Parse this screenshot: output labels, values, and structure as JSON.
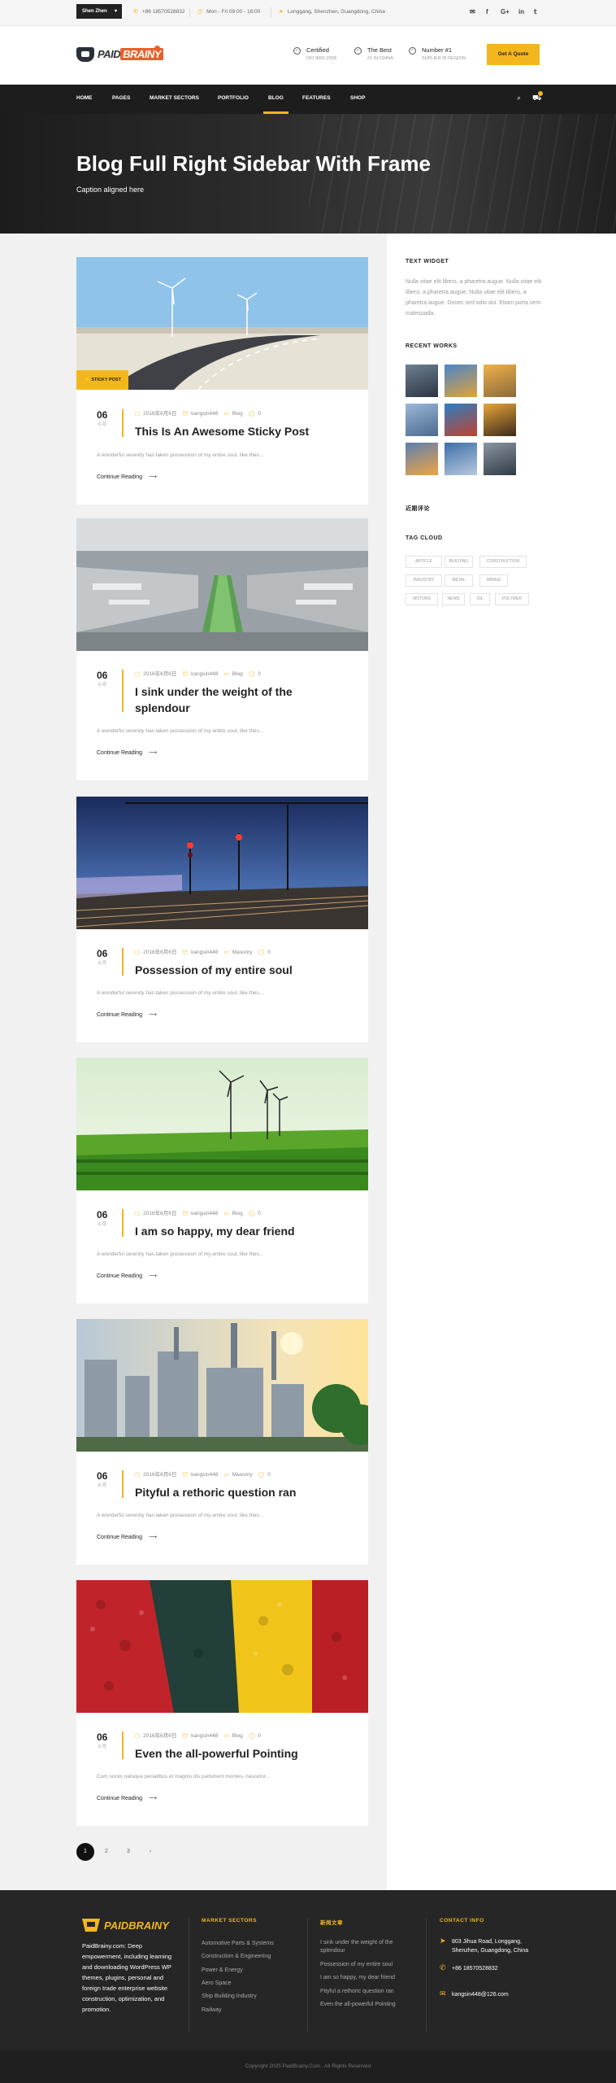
{
  "topbar": {
    "language": "Shen Zhen",
    "phone": "+86 18570528832",
    "hours": "Mon - Fri 09:00 - 18:00",
    "address": "Longgang, Shenzhen, Guangdong, China"
  },
  "header": {
    "logo_main": "PAID",
    "logo_accent": "BRAINY",
    "features": [
      {
        "title": "Certified",
        "sub": "ISO 9001:2008"
      },
      {
        "title": "The Best",
        "sub": "#1 IN CHINA"
      },
      {
        "title": "Number #1",
        "sub": "SUPLIER IN REGION"
      }
    ],
    "quote_button": "Get A Quote"
  },
  "nav": {
    "items": [
      "HOME",
      "PAGES",
      "MARKET SECTORS",
      "PORTFOLIO",
      "BLOG",
      "FEATURES",
      "SHOP"
    ],
    "active": "BLOG"
  },
  "hero": {
    "title": "Blog Full Right Sidebar With Frame",
    "caption": "Caption aligned here"
  },
  "posts": [
    {
      "day": "06",
      "month": "6 月",
      "date": "2016年6月6日",
      "author": "kangsin448",
      "category": "Blog",
      "comments": "0",
      "title": "This Is An Awesome Sticky Post",
      "excerpt": "A wonderful serenity has taken possession of my entire soul, like thes...",
      "more": "Continue Reading",
      "sticky": "STICKY POST",
      "image": "wind-turbines-road"
    },
    {
      "day": "06",
      "month": "6 月",
      "date": "2016年6月6日",
      "author": "kangsin448",
      "category": "Blog",
      "comments": "0",
      "title": "I sink under the weight of the splendour",
      "excerpt": "A wonderful serenity has taken possession of my entire soul, like thes...",
      "more": "Continue Reading",
      "image": "factory-conveyor"
    },
    {
      "day": "06",
      "month": "6 月",
      "date": "2016年6月6日",
      "author": "kangsin448",
      "category": "Masonry",
      "comments": "0",
      "title": "Possession of my entire soul",
      "excerpt": "A wonderful serenity has taken possession of my entire soul, like thes...",
      "more": "Continue Reading",
      "image": "railway-signals"
    },
    {
      "day": "06",
      "month": "6 月",
      "date": "2016年6月6日",
      "author": "kangsin448",
      "category": "Blog",
      "comments": "0",
      "title": "I am so happy, my dear friend",
      "excerpt": "A wonderful serenity has taken possession of my entire soul, like thes...",
      "more": "Continue Reading",
      "image": "wind-farm-field"
    },
    {
      "day": "06",
      "month": "6 月",
      "date": "2016年6月6日",
      "author": "kangsin448",
      "category": "Masonry",
      "comments": "0",
      "title": "Pityful a rethoric question ran",
      "excerpt": "A wonderful serenity has taken possession of my entire soul, like thes...",
      "more": "Continue Reading",
      "image": "power-plant"
    },
    {
      "day": "06",
      "month": "6 月",
      "date": "2016年6月6日",
      "author": "kangsin448",
      "category": "Blog",
      "comments": "0",
      "title": "Even the all-powerful Pointing",
      "excerpt": "Cum sociis natoque penatibus et magnis dis parturient montes, nascetur...",
      "more": "Continue Reading",
      "image": "plastic-pellets"
    }
  ],
  "pagination": [
    "1",
    "2",
    "3",
    "›"
  ],
  "sidebar": {
    "text_widget_title": "TEXT WIDGET",
    "text_widget_body": "Nulla vitae elit libero, a pharetra augue. Nulla vitae elit libero, a pharetra augue. Nulla vitae elit libero, a pharetra augue. Donec sed odio dui. Etiam porta sem malesuada.",
    "recent_works_title": "RECENT WORKS",
    "recent_comments_title": "近期评论",
    "tag_cloud_title": "TAG CLOUD",
    "tags": [
      "ARTICLE",
      "BUILDING",
      "CONSTRUCTION",
      "INDUSTRY",
      "METAL",
      "MINING",
      "MOTORS",
      "NEWS",
      "OIL",
      "POLYMER"
    ]
  },
  "footer": {
    "about": "PaidBrainy.com: Deep empowerment, including learning and downloading WordPress WP themes, plugins, personal and foreign trade enterprise website construction, optimization, and promotion.",
    "market_title": "MARKET SECTORS",
    "market_links": [
      "Automotive Parts & Systems",
      "Construction & Engineering",
      "Power & Energy",
      "Aero Space",
      "Ship Building Industry",
      "Railway"
    ],
    "recent_title": "新闻文章",
    "recent_links": [
      "I sink under the weight of the splendour",
      "Possession of my entire soul",
      "I am so happy, my dear friend",
      "Pityful a rethoric question ran",
      "Even the all-powerful Pointing"
    ],
    "contact_title": "CONTACT INFO",
    "address": "803 Jihua Road, Longgang, Shenzhen, Guangdong, China",
    "phone": "+86 18570528832",
    "email": "kangsin448@126.com",
    "copyright": "Copyright 2025 PaidBrainy.Com , All Rights Reserved"
  },
  "colors": {
    "accent": "#f3b71d",
    "dark": "#1d1d1d",
    "footer": "#262626"
  }
}
